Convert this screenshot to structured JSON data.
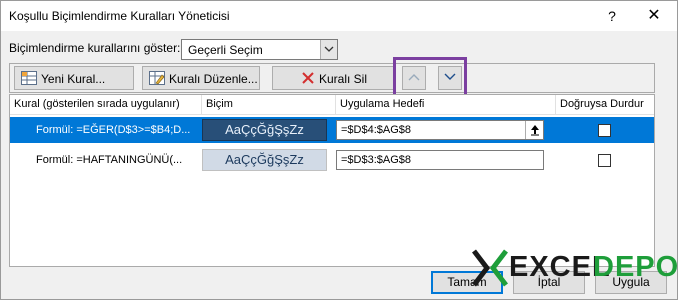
{
  "window": {
    "title": "Koşullu Biçimlendirme Kuralları Yöneticisi",
    "help_symbol": "?",
    "close_symbol": "✕"
  },
  "show_rules": {
    "label": "Biçimlendirme kurallarını göster:",
    "selected": "Geçerli Seçim"
  },
  "toolbar": {
    "new_rule": "Yeni Kural...",
    "edit_rule": "Kuralı Düzenle...",
    "delete_rule": "Kuralı Sil",
    "move_up_icon": "chevron-up-icon",
    "move_down_icon": "chevron-down-icon"
  },
  "grid": {
    "columns": [
      "Kural (gösterilen sırada uygulanır)",
      "Biçim",
      "Uygulama Hedefi",
      "Doğruysa Durdur"
    ],
    "rows": [
      {
        "rule": "Formül: =EĞER(D$3>=$B4;D...",
        "format_preview": "AaÇçĞğŞşZz",
        "applies_to": "=$D$4:$AG$8",
        "stop_if_true": false,
        "selected": true
      },
      {
        "rule": "Formül: =HAFTANINGÜNÜ(...",
        "format_preview": "AaÇçĞğŞşZz",
        "applies_to": "=$D$3:$AG$8",
        "stop_if_true": false,
        "selected": false
      }
    ]
  },
  "footer": {
    "ok": "Tamam",
    "cancel": "İptal",
    "apply": "Uygula"
  },
  "watermark": {
    "part1": "EXCEL",
    "part2": "DEPO"
  },
  "colors": {
    "selection": "#0078d7",
    "highlight_box": "#7b3fa0",
    "brand_green": "#1e9e3a"
  }
}
